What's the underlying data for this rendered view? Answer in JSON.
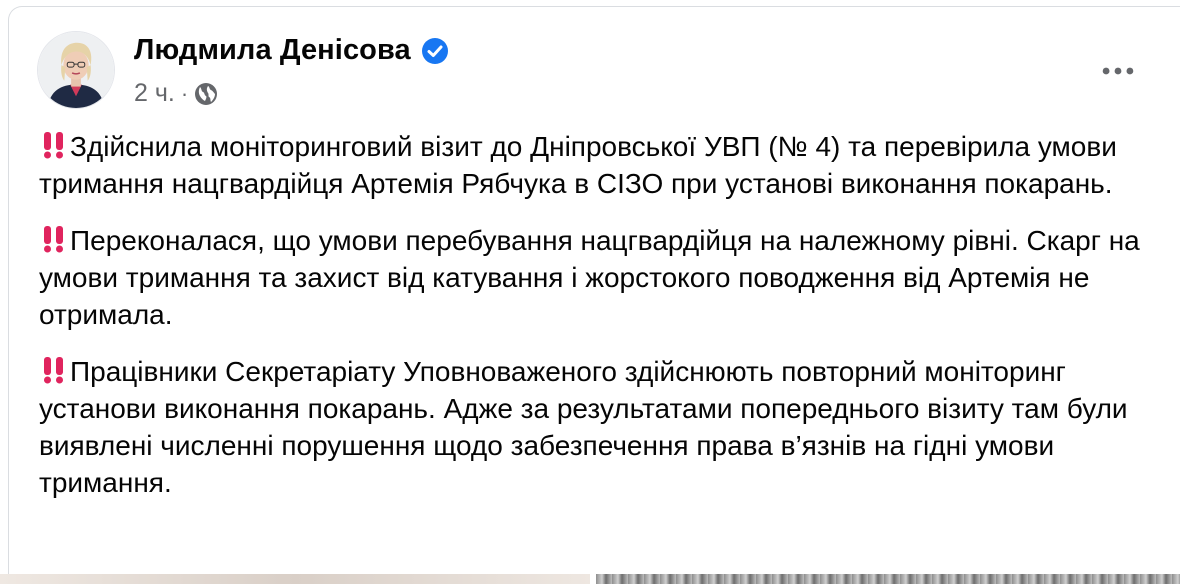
{
  "post": {
    "author": "Людмила Денісова",
    "time": "2 ч.",
    "separator": "·",
    "icons": {
      "verified": "verified-badge-icon",
      "audience": "globe-icon",
      "more": "more-options-icon"
    },
    "paragraphs": [
      {
        "emoji": "‼️",
        "text": "Здійснила моніторинговий візит до Дніпровської УВП (№ 4) та перевірила умови тримання нацгвардійця Артемія Рябчука в СІЗО при установі виконання покарань."
      },
      {
        "emoji": "‼️",
        "text": "Переконалася, що умови перебування нацгвардійця на належному рівні. Скарг на умови тримання та захист від катування і жорстокого поводження від Артемія не отримала."
      },
      {
        "emoji": "‼️",
        "text": "Працівники Секретаріату Уповноваженого здійснюють повторний моніторинг установи виконання покарань. Адже за результатами попереднього візиту там були виявлені численні порушення щодо забезпечення права в’язнів на гідні умови тримання."
      }
    ]
  },
  "colors": {
    "verified": "#1877f2",
    "secondary_text": "#65676b",
    "emoji_red": "#e0245e",
    "text": "#050505"
  }
}
